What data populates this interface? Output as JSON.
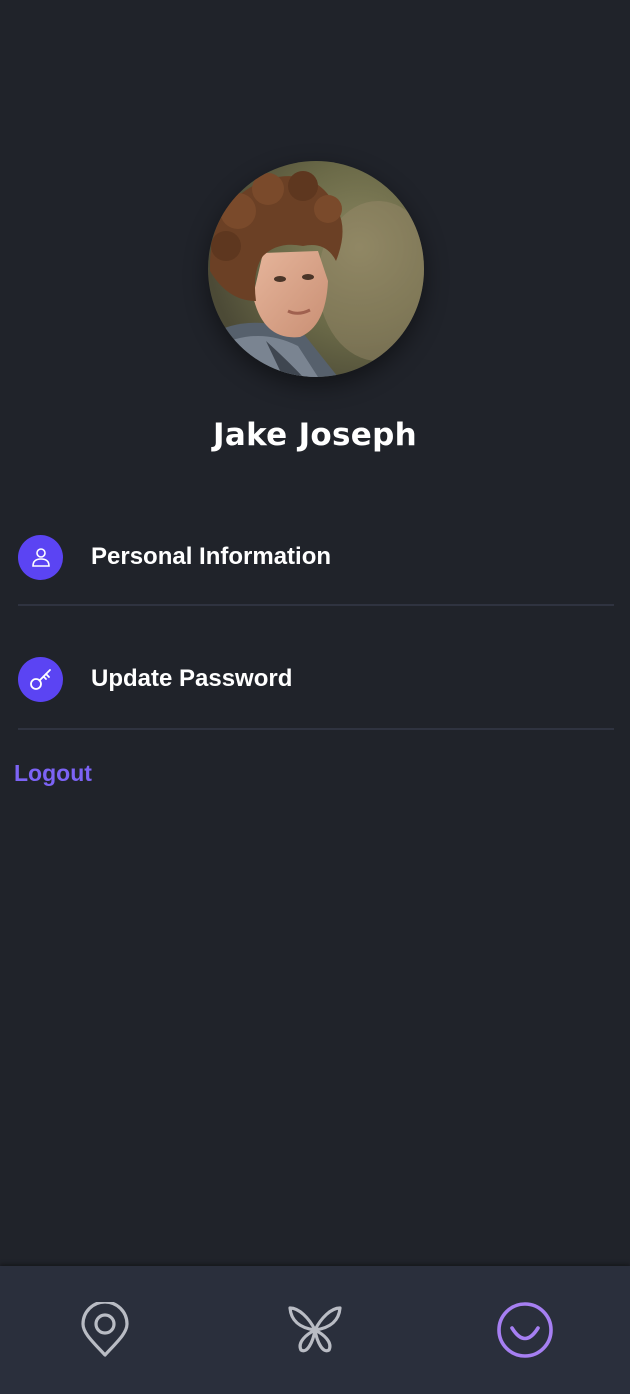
{
  "profile": {
    "name": "Jake Joseph"
  },
  "menu": {
    "items": [
      {
        "label": "Personal Information",
        "icon": "person-icon"
      },
      {
        "label": "Update Password",
        "icon": "key-icon"
      }
    ],
    "logout_label": "Logout"
  },
  "bottom_nav": {
    "items": [
      {
        "icon": "location-pin-icon",
        "active": false
      },
      {
        "icon": "butterfly-icon",
        "active": false
      },
      {
        "icon": "smile-icon",
        "active": true
      }
    ]
  },
  "colors": {
    "background": "#20232a",
    "accent": "#5b44f3",
    "logout": "#7c63f5",
    "nav_background": "#2a2f3c",
    "nav_icon_inactive": "#b9bcc4",
    "nav_icon_active": "#a67ff2"
  }
}
